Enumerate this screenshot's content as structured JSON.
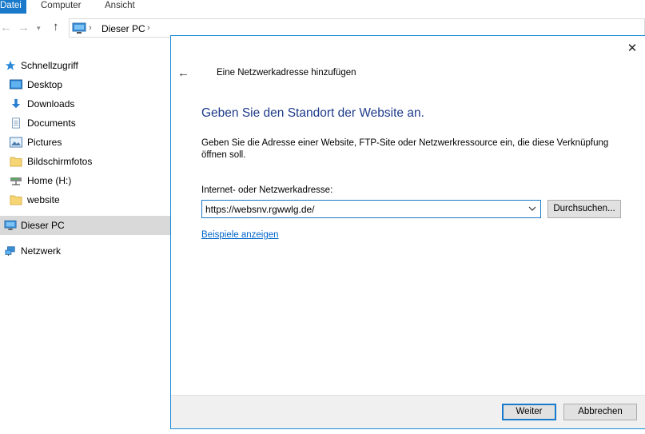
{
  "ribbon": {
    "tabs": [
      {
        "label": "Datei",
        "active": true
      },
      {
        "label": "Computer",
        "active": false
      },
      {
        "label": "Ansicht",
        "active": false
      }
    ]
  },
  "address_bar": {
    "path": "Dieser PC"
  },
  "nav_pane": {
    "items": [
      {
        "label": "Schnellzugriff",
        "icon": "star-icon"
      },
      {
        "label": "Desktop",
        "icon": "desktop-icon"
      },
      {
        "label": "Downloads",
        "icon": "download-icon"
      },
      {
        "label": "Documents",
        "icon": "documents-icon"
      },
      {
        "label": "Pictures",
        "icon": "pictures-icon"
      },
      {
        "label": "Bildschirmfotos",
        "icon": "folder-icon"
      },
      {
        "label": "Home (H:)",
        "icon": "network-drive-icon"
      },
      {
        "label": "website",
        "icon": "folder-icon"
      },
      {
        "label": "Dieser PC",
        "icon": "computer-icon",
        "selected": true
      },
      {
        "label": "Netzwerk",
        "icon": "network-icon"
      }
    ]
  },
  "dialog": {
    "title": "Eine Netzwerkadresse hinzufügen",
    "heading": "Geben Sie den Standort der Website an.",
    "description": "Geben Sie die Adresse einer Website, FTP-Site oder Netzwerkressource ein, die diese Verknüpfung öffnen soll.",
    "field_label": "Internet- oder Netzwerkadresse:",
    "address_value": "https://websnv.rgwwlg.de/",
    "browse_label": "Durchsuchen...",
    "examples_link": "Beispiele anzeigen",
    "next_label": "Weiter",
    "cancel_label": "Abbrechen"
  },
  "colors": {
    "accent": "#1979ca",
    "heading": "#1e3b8a",
    "link": "#0066cc",
    "selection": "#d9d9d9"
  }
}
